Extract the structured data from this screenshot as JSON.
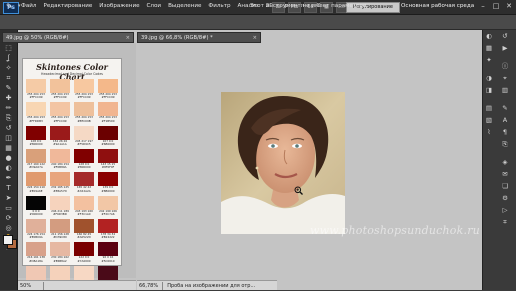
{
  "app": {
    "logo": "Ps"
  },
  "menu": [
    "Файл",
    "Редактирование",
    "Изображение",
    "Слои",
    "Выделение",
    "Фильтр",
    "Анализ",
    "3D",
    "Просмотр",
    "Окно",
    "Справка"
  ],
  "toolbar_icons": [
    {
      "icon": "bridge-icon",
      "glyph": "Br"
    },
    {
      "icon": "minibridge-icon",
      "glyph": "Mb"
    },
    {
      "icon": "zoom-level-icon",
      "glyph": "66"
    },
    {
      "icon": "arrange-icon",
      "glyph": "▦"
    },
    {
      "icon": "screen-mode-icon",
      "glyph": "▭"
    }
  ],
  "workspace": {
    "button": "Регулирование",
    "label": "Основная рабочая среда"
  },
  "window_controls": {
    "minimize": "–",
    "restore": "□",
    "close": "✕"
  },
  "options_bar": {
    "tool_icon": "eyedropper-icon",
    "message": "Этот инструмент не имеет параметров."
  },
  "documents": [
    {
      "tab": "49.jpg @ 50% (RGB/8#)",
      "zoom": "50%"
    },
    {
      "tab": "39.jpg @ 66,8% (RGB/8#) *",
      "zoom": "66,78%",
      "status": "Проба на изображении для отр..."
    }
  ],
  "chart_doc": {
    "title": "Skintones Color Chart",
    "subtitle": "Hexadecimal and Decimal Color Codes",
    "swatches": [
      {
        "color": "#f5cba6",
        "label": "255 204 153",
        "hex": "#FFCC99"
      },
      {
        "color": "#f2c29b",
        "label": "255 204 153",
        "hex": "#FFCC99"
      },
      {
        "color": "#f7c8a0",
        "label": "255 204 153",
        "hex": "#FFCC99"
      },
      {
        "color": "#f4b88a",
        "label": "255 204 153",
        "hex": "#FFCC99"
      },
      {
        "color": "#f8d6b3",
        "label": "255 204 153",
        "hex": "#FFDDB3"
      },
      {
        "color": "#f3c5a4",
        "label": "255 204 153",
        "hex": "#FFCC99"
      },
      {
        "color": "#eec09b",
        "label": "255 204 153",
        "hex": "#EEC09B"
      },
      {
        "color": "#f1b590",
        "label": "255 204 153",
        "hex": "#F1B590"
      },
      {
        "color": "#800000",
        "label": "128 0 0",
        "hex": "#800000"
      },
      {
        "color": "#9a1a1a",
        "label": "154 26 26",
        "hex": "#9A1A1A"
      },
      {
        "color": "#f5d9c5",
        "label": "245 217 197",
        "hex": "#F5D9C5"
      },
      {
        "color": "#6b0000",
        "label": "107 0 0",
        "hex": "#6B0000"
      },
      {
        "color": "#d9a07a",
        "label": "217 160 122",
        "hex": "#D9A07A"
      },
      {
        "color": "#f0b89a",
        "label": "240 184 154",
        "hex": "#F0B89A"
      },
      {
        "color": "#800000",
        "label": "128 0 0",
        "hex": "#800000"
      },
      {
        "color": "#8f0f0f",
        "label": "143 15 15",
        "hex": "#8F0F0F"
      },
      {
        "color": "#e09a6e",
        "label": "224 154 110",
        "hex": "#E09A6E"
      },
      {
        "color": "#e8a57d",
        "label": "232 165 125",
        "hex": "#E8A57D"
      },
      {
        "color": "#a52a2a",
        "label": "165 42 42",
        "hex": "#A52A2A"
      },
      {
        "color": "#8b0000",
        "label": "139 0 0",
        "hex": "#8B0000"
      },
      {
        "color": "#050505",
        "label": "0 0 0",
        "hex": "#000000"
      },
      {
        "color": "#f6d3bd",
        "label": "246 211 189",
        "hex": "#F6D3BD"
      },
      {
        "color": "#f3c1a0",
        "label": "243 193 160",
        "hex": "#F3C1A0"
      },
      {
        "color": "#f2c7a6",
        "label": "242 199 166",
        "hex": "#F2C7A6"
      },
      {
        "color": "#e0b09a",
        "label": "224 176 154",
        "hex": "#E0B09A"
      },
      {
        "color": "#d39c80",
        "label": "211 156 128",
        "hex": "#D39C80"
      },
      {
        "color": "#a0522d",
        "label": "160 82 45",
        "hex": "#A0522D"
      },
      {
        "color": "#b22222",
        "label": "178 34 34",
        "hex": "#B22222"
      },
      {
        "color": "#d8a18a",
        "label": "216 161 138",
        "hex": "#D8A18A"
      },
      {
        "color": "#e6b8a2",
        "label": "230 184 162",
        "hex": "#E6B8A2"
      },
      {
        "color": "#7a0000",
        "label": "122 0 0",
        "hex": "#7A0000"
      },
      {
        "color": "#5c0010",
        "label": "92 0 16",
        "hex": "#5C0010"
      },
      {
        "color": "#f0c8b4",
        "label": "240 200 180",
        "hex": "#F0C8B4"
      },
      {
        "color": "#f5d2bb",
        "label": "245 210 187",
        "hex": "#F5D2BB"
      },
      {
        "color": "#f7d8c4",
        "label": "247 216 196",
        "hex": "#F7D8C4"
      },
      {
        "color": "#4a0a18",
        "label": "74 10 24",
        "hex": "#4A0A18"
      }
    ]
  },
  "photo": {
    "watermark": "www.photoshopsunduchok.ru"
  },
  "tools_panel": [
    "move-icon",
    "marquee-icon",
    "lasso-icon",
    "quick-select-icon",
    "crop-icon",
    "eyedropper-icon",
    "healing-icon",
    "brush-icon",
    "clone-stamp-icon",
    "history-brush-icon",
    "eraser-icon",
    "gradient-icon",
    "blur-icon",
    "dodge-icon",
    "pen-icon",
    "type-icon",
    "path-select-icon",
    "shape-icon",
    "3d-rotate-icon",
    "3d-orbit-icon",
    "hand-icon",
    "zoom-icon"
  ],
  "right_dock": {
    "col1": [
      "color-panel-icon",
      "swatches-panel-icon",
      "styles-panel-icon",
      "adjustments-panel-icon",
      "masks-panel-icon",
      "layers-panel-icon",
      "channels-panel-icon",
      "paths-panel-icon"
    ],
    "col2": [
      "history-panel-icon",
      "actions-panel-icon",
      "info-panel-icon",
      "navigator-panel-icon",
      "histogram-panel-icon",
      "brush-panel-icon",
      "character-panel-icon",
      "paragraph-panel-icon",
      "clone-source-panel-icon",
      "3d-panel-icon",
      "notes-panel-icon",
      "layer-comps-panel-icon",
      "tool-presets-panel-icon",
      "animation-panel-icon",
      "measurement-panel-icon"
    ]
  }
}
